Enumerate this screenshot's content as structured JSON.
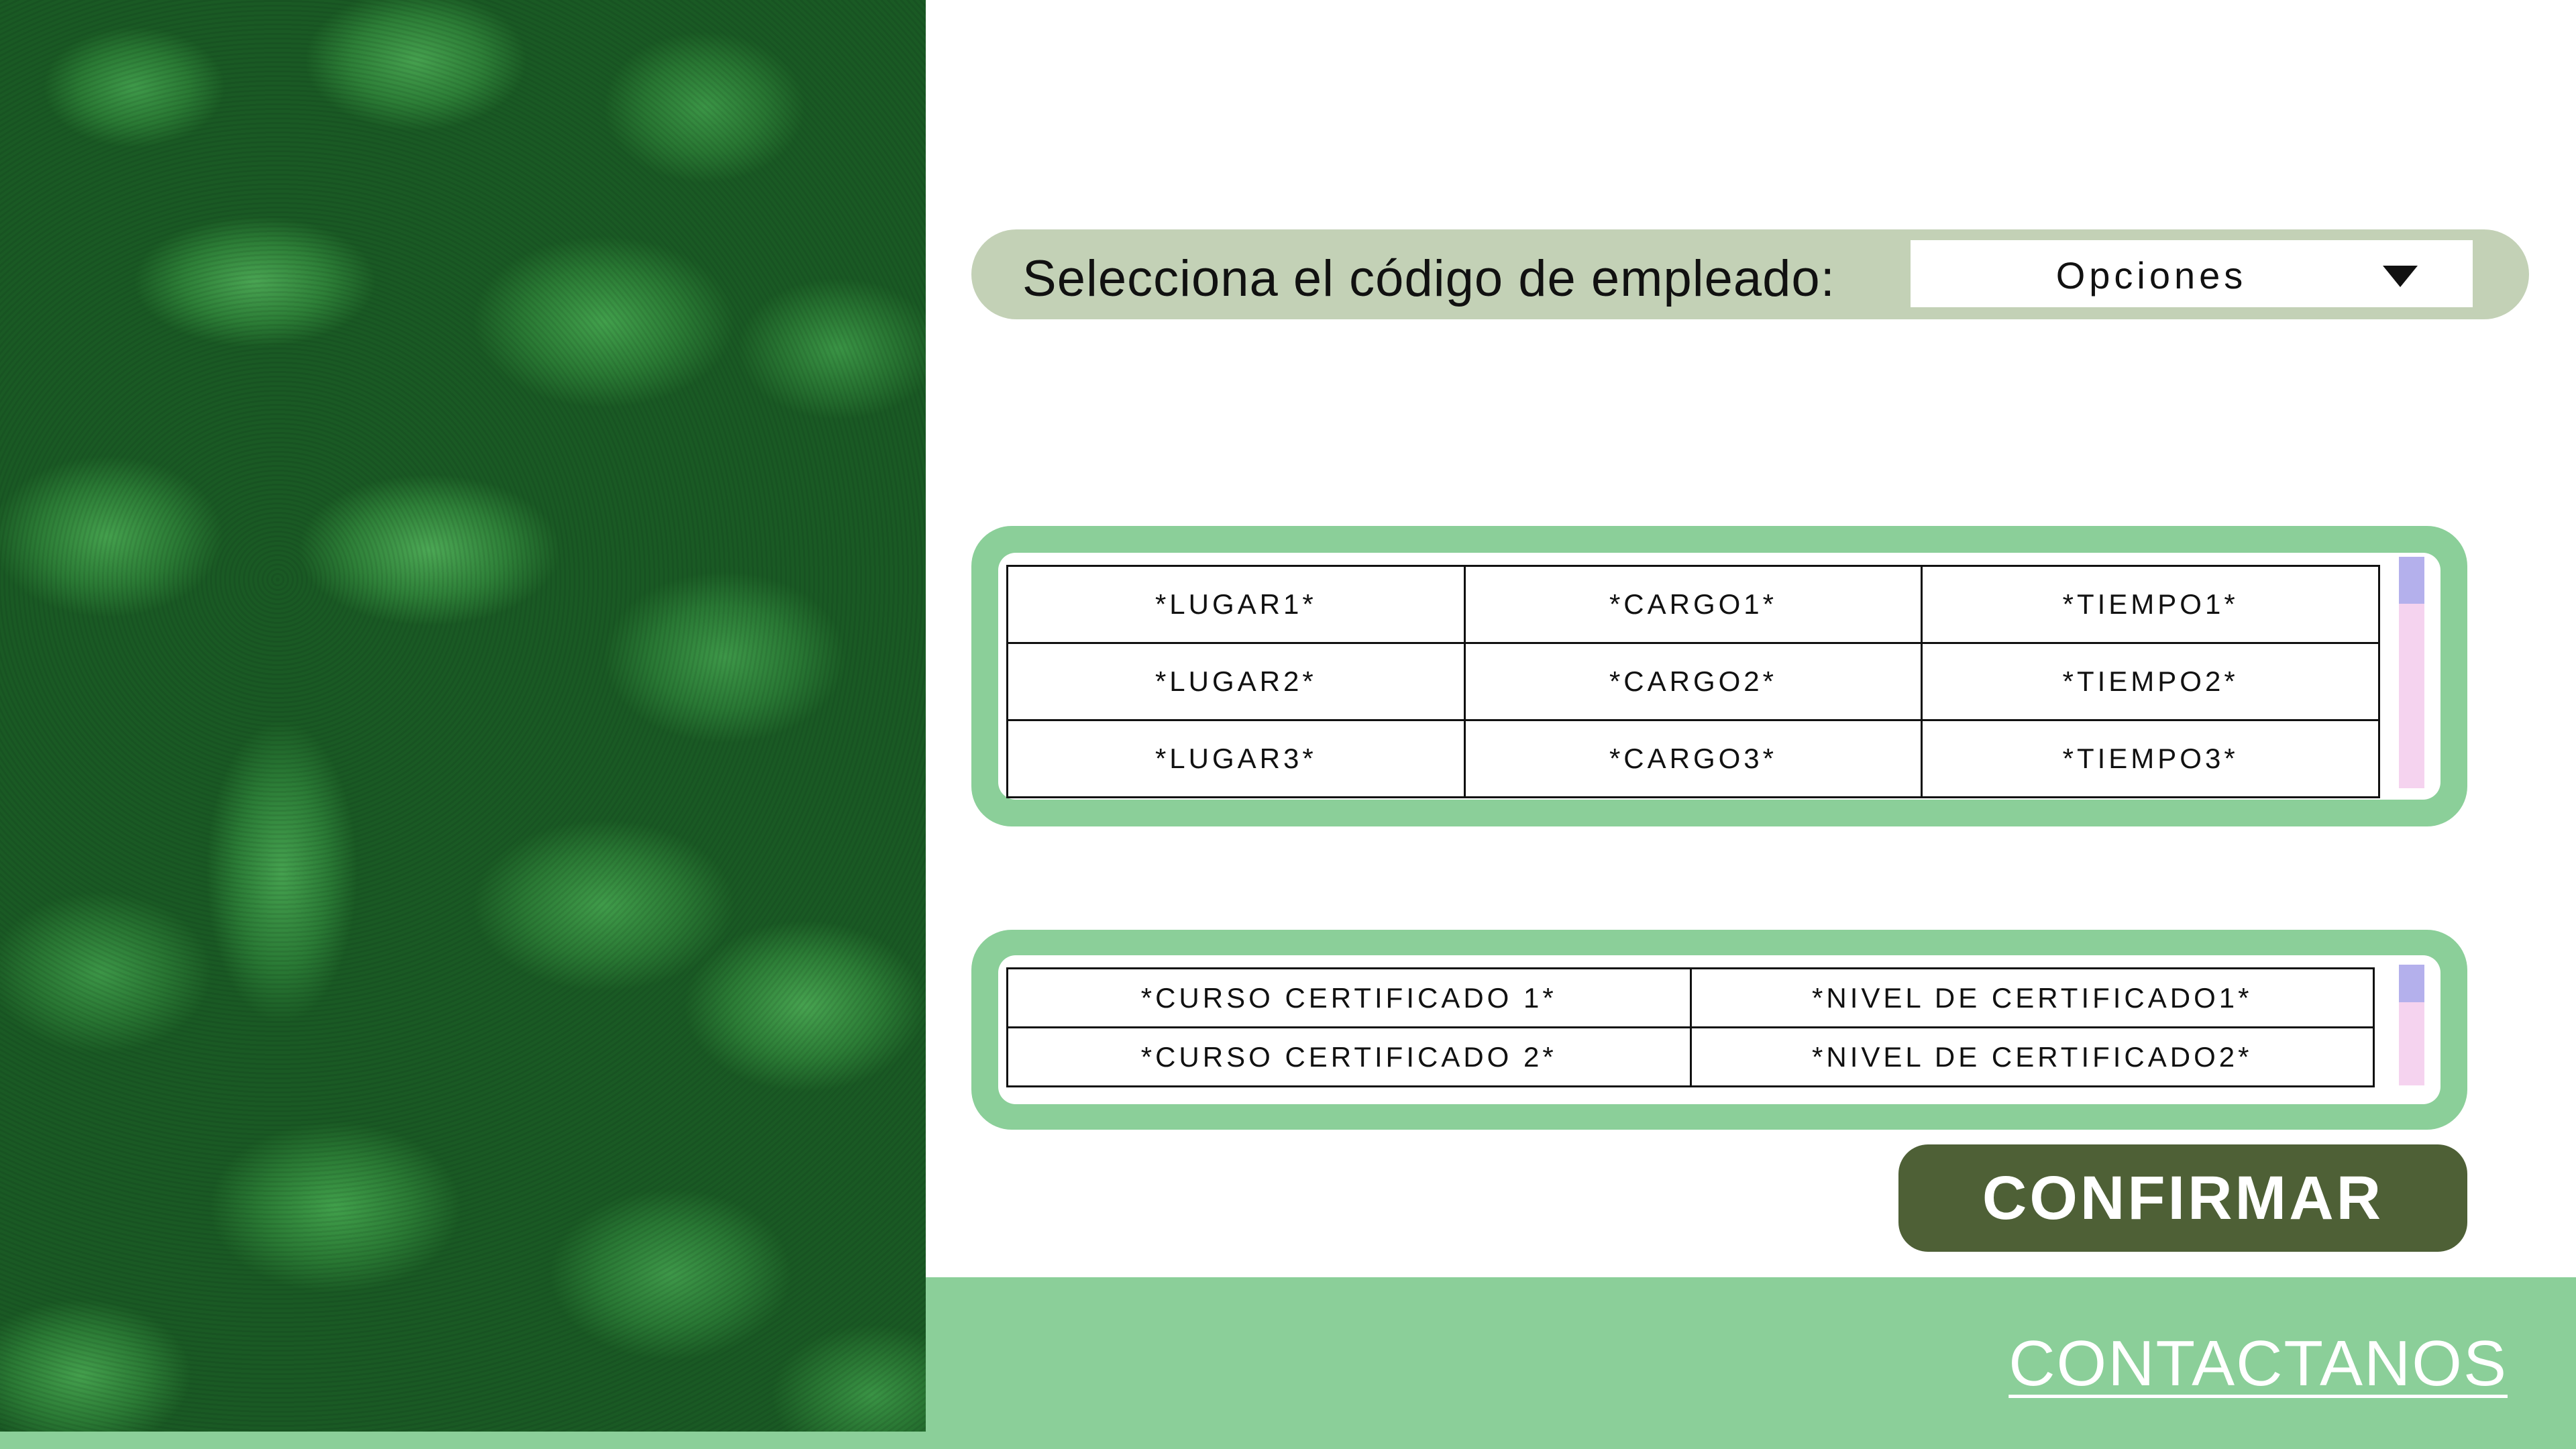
{
  "selector": {
    "label": "Selecciona el código de empleado:",
    "value": "Opciones"
  },
  "experience_table": {
    "rows": [
      [
        "*LUGAR1*",
        "*CARGO1*",
        "*TIEMPO1*"
      ],
      [
        "*LUGAR2*",
        "*CARGO2*",
        "*TIEMPO2*"
      ],
      [
        "*LUGAR3*",
        "*CARGO3*",
        "*TIEMPO3*"
      ]
    ]
  },
  "certificates_table": {
    "rows": [
      [
        "*CURSO CERTIFICADO 1*",
        "*NIVEL DE CERTIFICADO1*"
      ],
      [
        "*CURSO CERTIFICADO 2*",
        "*NIVEL DE CERTIFICADO2*"
      ]
    ]
  },
  "confirm_label": "CONFIRMAR",
  "contact_label": "CONTACTANOS",
  "colors": {
    "panel_green": "#8bcf99",
    "selector_bg": "#c3d1b6",
    "button_bg": "#4e6036",
    "scroll_thumb": "#b4b0ec",
    "scroll_track": "#f5d3ef"
  },
  "image": {
    "subject": "avocados"
  }
}
